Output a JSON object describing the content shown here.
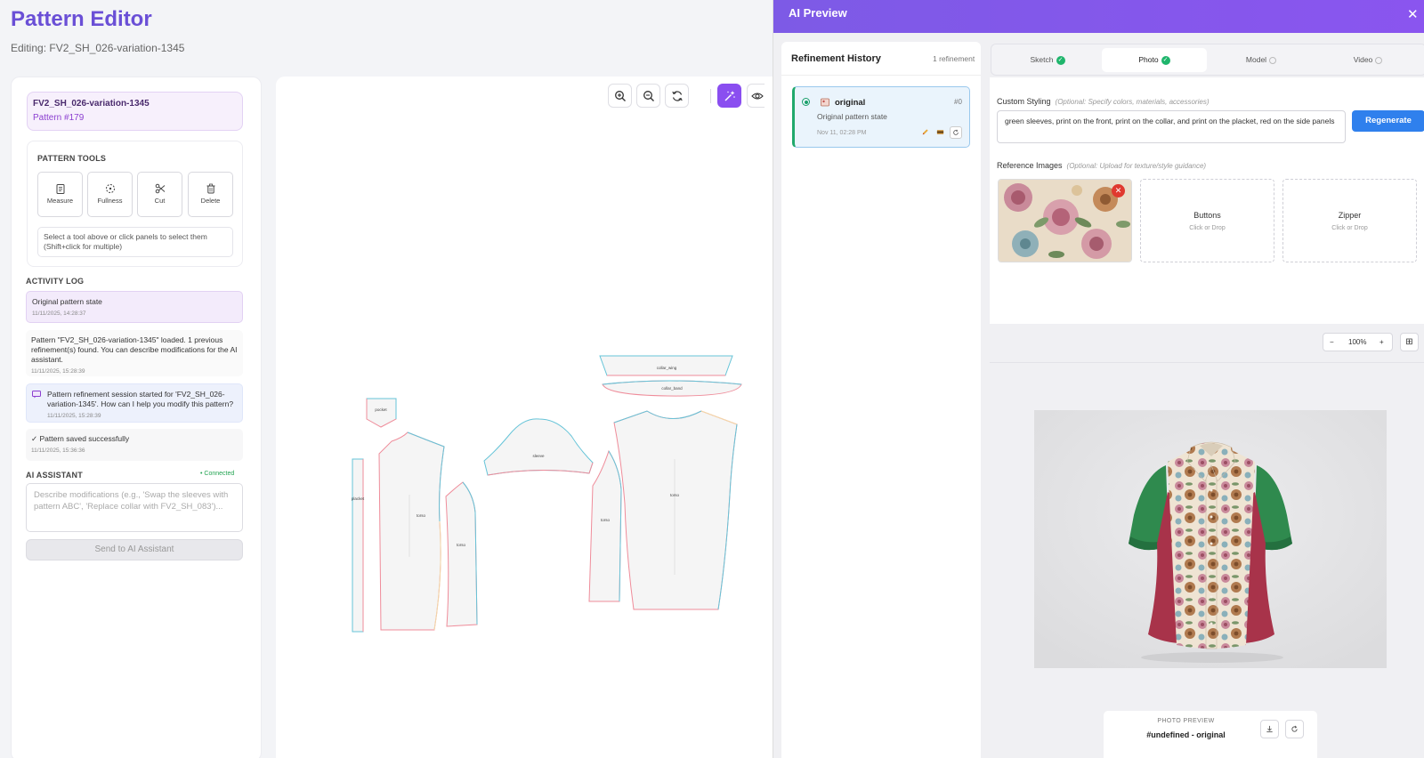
{
  "header": {
    "title": "Pattern Editor",
    "subtitle": "Editing: FV2_SH_026-variation-1345"
  },
  "sidebar": {
    "pattern_name": "FV2_SH_026-variation-1345",
    "pattern_number": "Pattern #179",
    "tools_title": "PATTERN TOOLS",
    "tools": [
      {
        "label": "Measure",
        "icon": "clipboard-icon"
      },
      {
        "label": "Fullness",
        "icon": "fullness-icon"
      },
      {
        "label": "Cut",
        "icon": "scissors-icon"
      },
      {
        "label": "Delete",
        "icon": "trash-icon"
      }
    ],
    "tools_hint": "Select a tool above or click panels to select them (Shift+click for multiple)",
    "activity_title": "ACTIVITY LOG",
    "activity": [
      {
        "text": "Original pattern state",
        "time": "11/11/2025, 14:28:37"
      },
      {
        "text": "Pattern \"FV2_SH_026-variation-1345\" loaded. 1 previous refinement(s) found. You can describe modifications for the AI assistant.",
        "time": "11/11/2025, 15:28:39"
      },
      {
        "text": "Pattern refinement session started for 'FV2_SH_026-variation-1345'. How can I help you modify this pattern?",
        "time": "11/11/2025, 15:28:39"
      },
      {
        "text": "✓ Pattern saved successfully",
        "time": "11/11/2025, 15:36:36"
      }
    ],
    "assistant_title": "AI ASSISTANT",
    "assistant_status": "• Connected",
    "assistant_placeholder": "Describe modifications (e.g., 'Swap the sleeves with pattern ABC', 'Replace collar with FV2_SH_083')...",
    "send_label": "Send to AI Assistant"
  },
  "canvas": {
    "toolbar": [
      "zoom-in-icon",
      "zoom-out-icon",
      "reset-icon",
      "magic-wand-icon",
      "eye-icon"
    ],
    "pieces": {
      "collar_wing": "collar_wing",
      "collar_band": "collar_band",
      "pocket": "pocket",
      "placket": "placket",
      "torso": "torso",
      "sleeve": "sleeve"
    }
  },
  "ai_panel": {
    "title": "AI Preview",
    "close": "✕",
    "history_title": "Refinement History",
    "history_count": "1 refinement",
    "history_items": [
      {
        "name": "original",
        "number": "#0",
        "desc": "Original pattern state",
        "time": "Nov 11, 02:28 PM"
      }
    ],
    "tabs": [
      {
        "label": "Sketch",
        "state": "done"
      },
      {
        "label": "Photo",
        "state": "done"
      },
      {
        "label": "Model",
        "state": "pending"
      },
      {
        "label": "Video",
        "state": "pending"
      }
    ],
    "styling_label": "Custom Styling",
    "styling_hint": "(Optional: Specify colors, materials, accessories)",
    "styling_value": "green sleeves, print on the front, print on the collar, and print on the placket, red on the side panels",
    "regenerate_label": "Regenerate",
    "reference_label": "Reference Images",
    "reference_hint": "(Optional: Upload for texture/style guidance)",
    "drop_zones": [
      {
        "title": "Buttons",
        "hint": "Click or Drop"
      },
      {
        "title": "Zipper",
        "hint": "Click or Drop"
      }
    ],
    "zoom": {
      "minus": "−",
      "value": "100%",
      "plus": "+"
    },
    "footer_label": "PHOTO PREVIEW",
    "footer_name": "#undefined - original"
  },
  "colors": {
    "accent": "#7d5ae6",
    "primary_button": "#2f80ed",
    "success": "#1fb56c",
    "danger": "#e0392f",
    "sleeve_green": "#2f8a4e",
    "side_red": "#a8334a"
  }
}
